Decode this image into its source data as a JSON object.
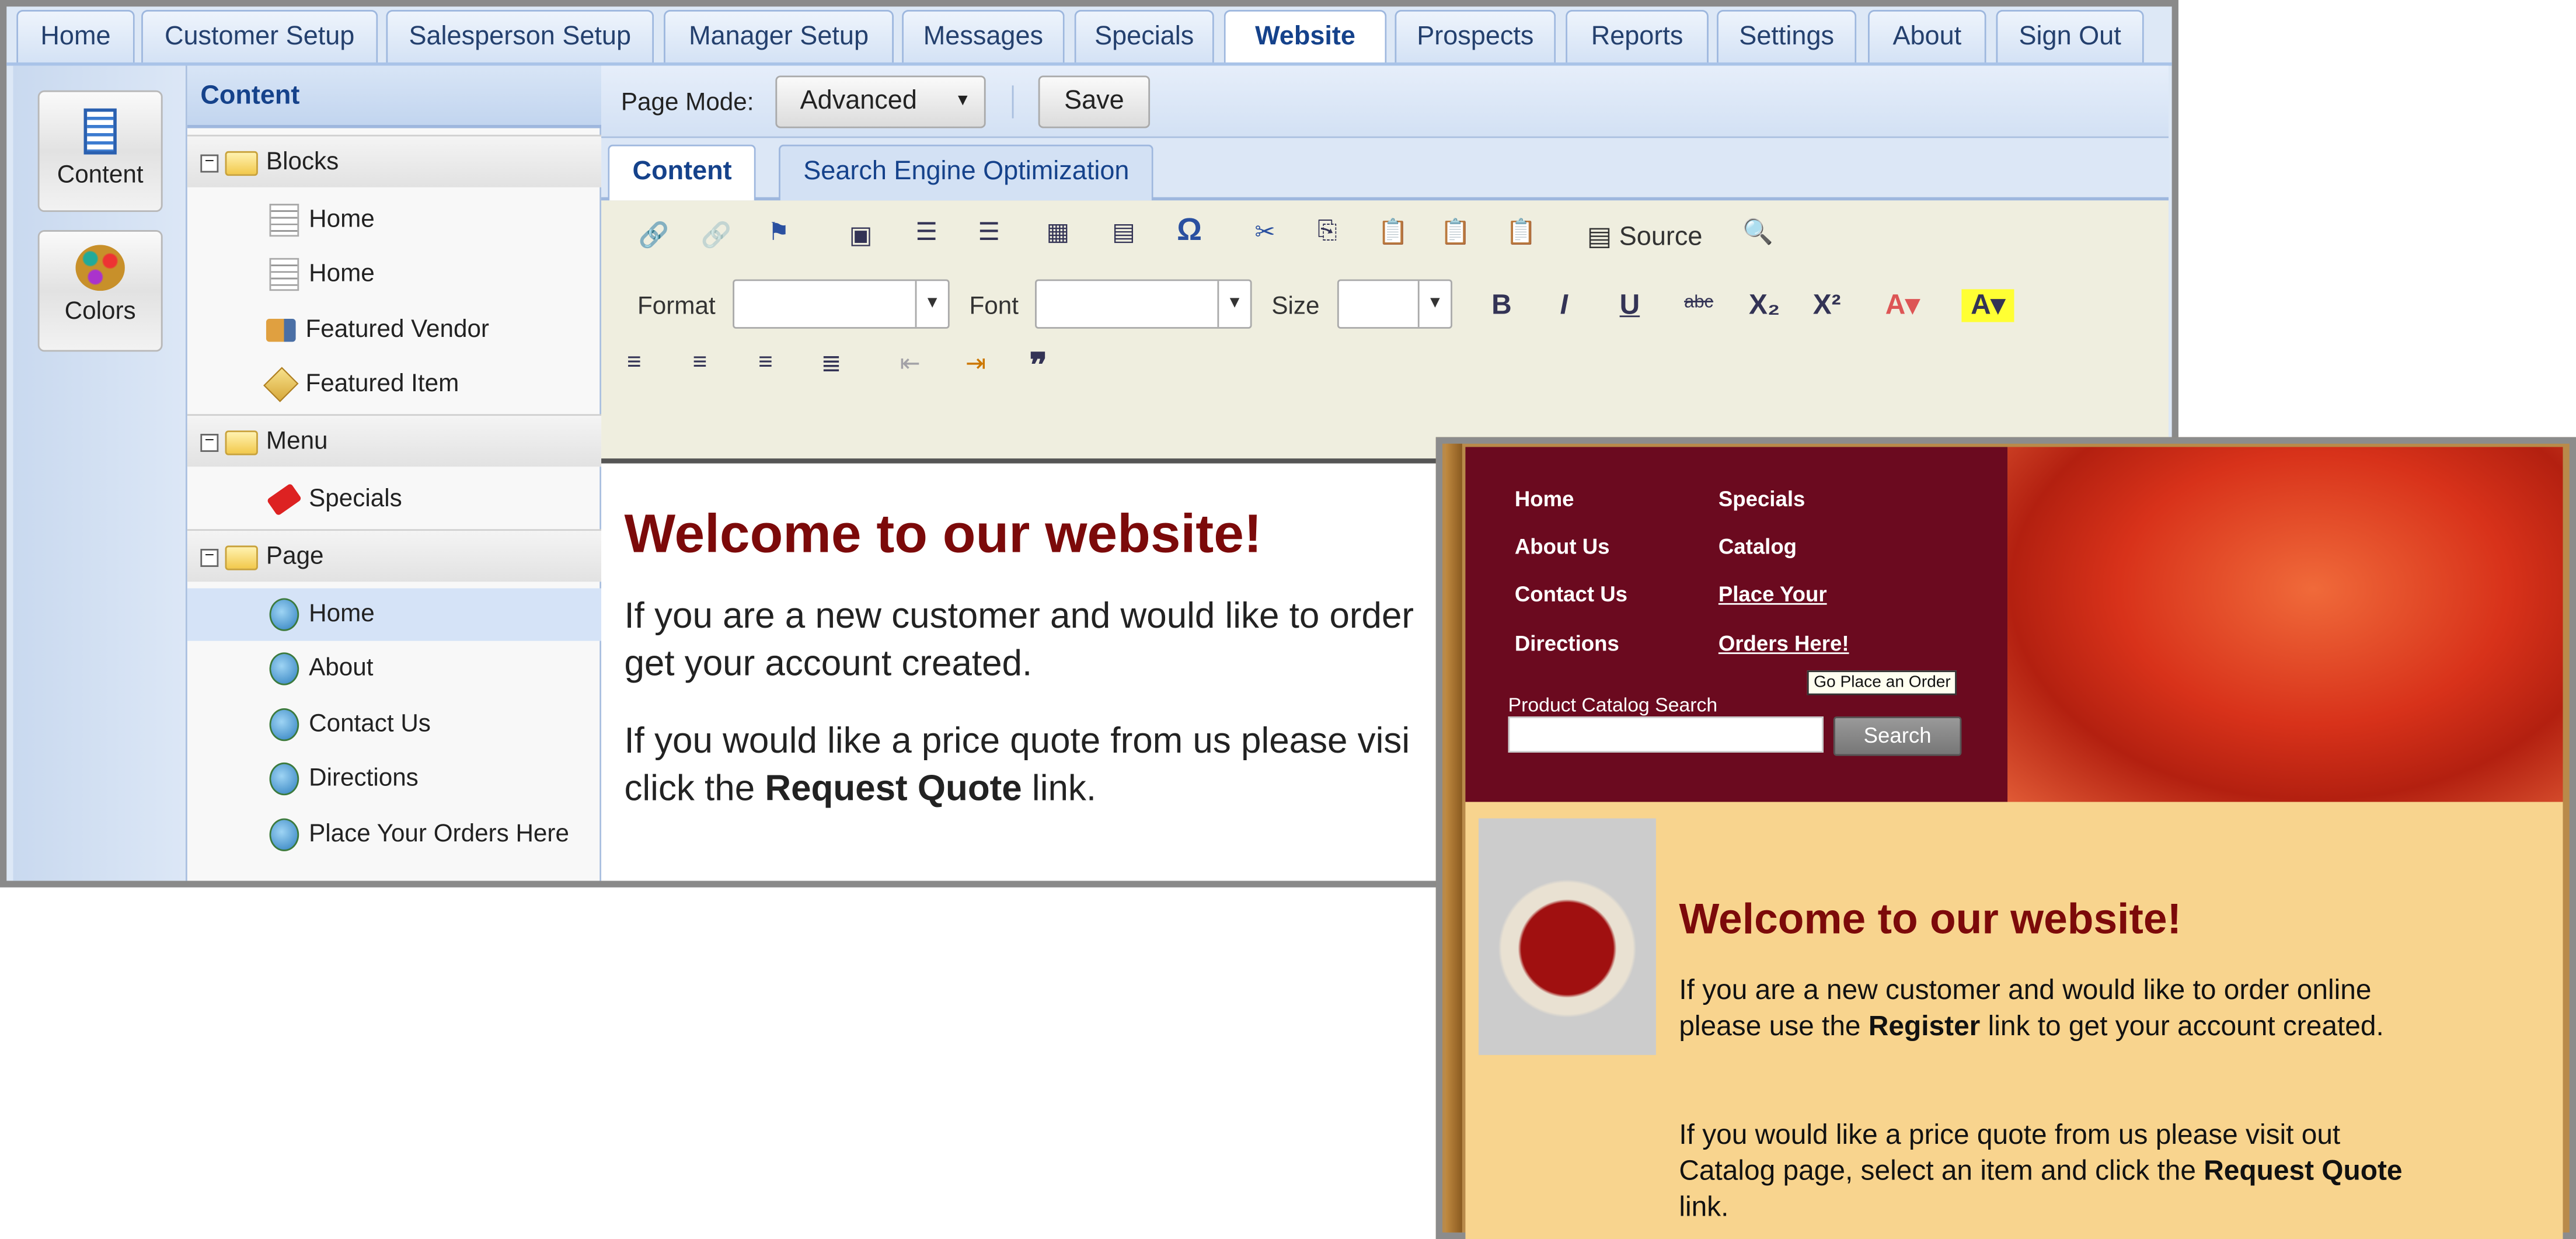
{
  "main_tabs": [
    "Home",
    "Customer Setup",
    "Salesperson Setup",
    "Manager Setup",
    "Messages",
    "Specials",
    "Website",
    "Prospects",
    "Reports",
    "Settings",
    "About",
    "Sign Out"
  ],
  "active_tab": "Website",
  "side_buttons": {
    "content": "Content",
    "colors": "Colors"
  },
  "tree": {
    "title": "Content",
    "groups": [
      {
        "label": "Blocks",
        "items": [
          "Home",
          "Home",
          "Featured Vendor",
          "Featured Item"
        ]
      },
      {
        "label": "Menu",
        "items": [
          "Specials"
        ]
      },
      {
        "label": "Page",
        "items": [
          "Home",
          "About",
          "Contact Us",
          "Directions",
          "Place Your Orders Here"
        ]
      }
    ],
    "selected": "Home"
  },
  "editor": {
    "page_mode_label": "Page Mode:",
    "page_mode_value": "Advanced",
    "save_label": "Save",
    "tabs": [
      "Content",
      "Search Engine Optimization"
    ],
    "toolbar": {
      "source": "Source",
      "format": "Format",
      "font": "Font",
      "size": "Size",
      "bold": "B",
      "italic": "I",
      "underline": "U",
      "strike": "abc",
      "sub": "X₂",
      "sup": "X²"
    },
    "content": {
      "heading": "Welcome to our website!",
      "p1": [
        "If you are a new customer and would like to order",
        "get your account created."
      ],
      "p2a": "If you would like a price quote from us please visi",
      "p2b_pre": "click the ",
      "p2b_bold": "Request Quote",
      "p2b_post": " link."
    }
  },
  "preview": {
    "nav_left": [
      "Home",
      "About Us",
      "Contact Us",
      "Directions"
    ],
    "nav_right": [
      "Specials",
      "Catalog",
      "Place Your",
      "Orders Here!"
    ],
    "tooltip": "Go Place an Order",
    "search_label": "Product Catalog Search",
    "search_value": "",
    "search_button": "Search",
    "heading": "Welcome to our website!",
    "p1_pre": "If you are a new customer and would like to order online please use the ",
    "p1_bold": "Register",
    "p1_post": " link to get your account created.",
    "p2_pre": "If you would like a price quote from us please visit out Catalog page, select an item and click the ",
    "p2_bold": "Request Quote",
    "p2_post": " link."
  },
  "colors": {
    "tab_blue": "#15428b",
    "maroon": "#6b0a1f",
    "heading_red": "#7c0a0a",
    "tan": "#f8d48e",
    "toolbar_bg": "#efeedf"
  }
}
